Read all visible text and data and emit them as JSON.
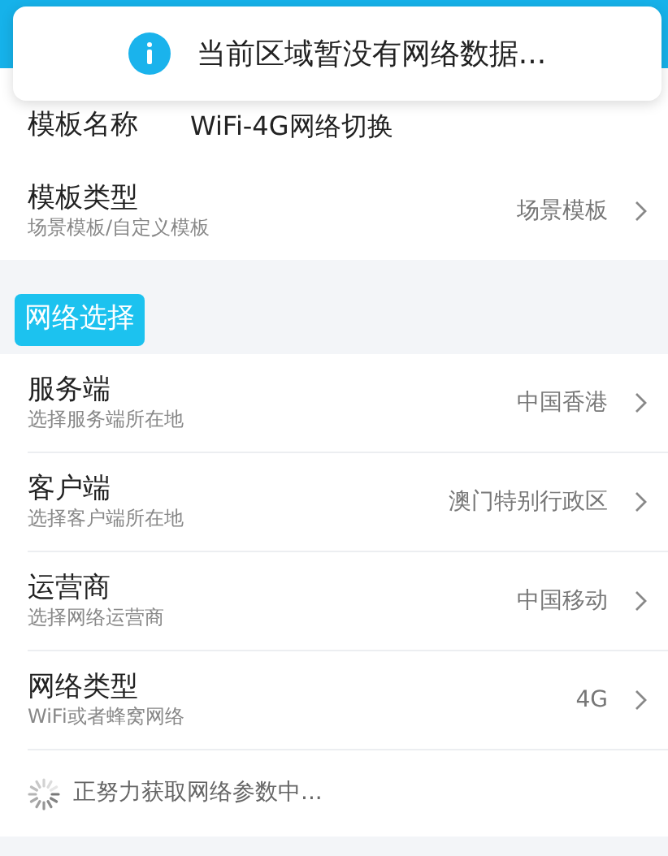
{
  "toast": {
    "text": "当前区域暂没有网络数据..."
  },
  "template_name": {
    "label": "模板名称",
    "value": "WiFi-4G网络切换"
  },
  "template_type": {
    "title": "模板类型",
    "subtitle": "场景模板/自定义模板",
    "value": "场景模板"
  },
  "section_chip": "网络选择",
  "settings": [
    {
      "title": "服务端",
      "subtitle": "选择服务端所在地",
      "value": "中国香港"
    },
    {
      "title": "客户端",
      "subtitle": "选择客户端所在地",
      "value": "澳门特别行政区"
    },
    {
      "title": "运营商",
      "subtitle": "选择网络运营商",
      "value": "中国移动"
    },
    {
      "title": "网络类型",
      "subtitle": "WiFi或者蜂窝网络",
      "value": "4G"
    }
  ],
  "loading": {
    "text": "正努力获取网络参数中..."
  }
}
